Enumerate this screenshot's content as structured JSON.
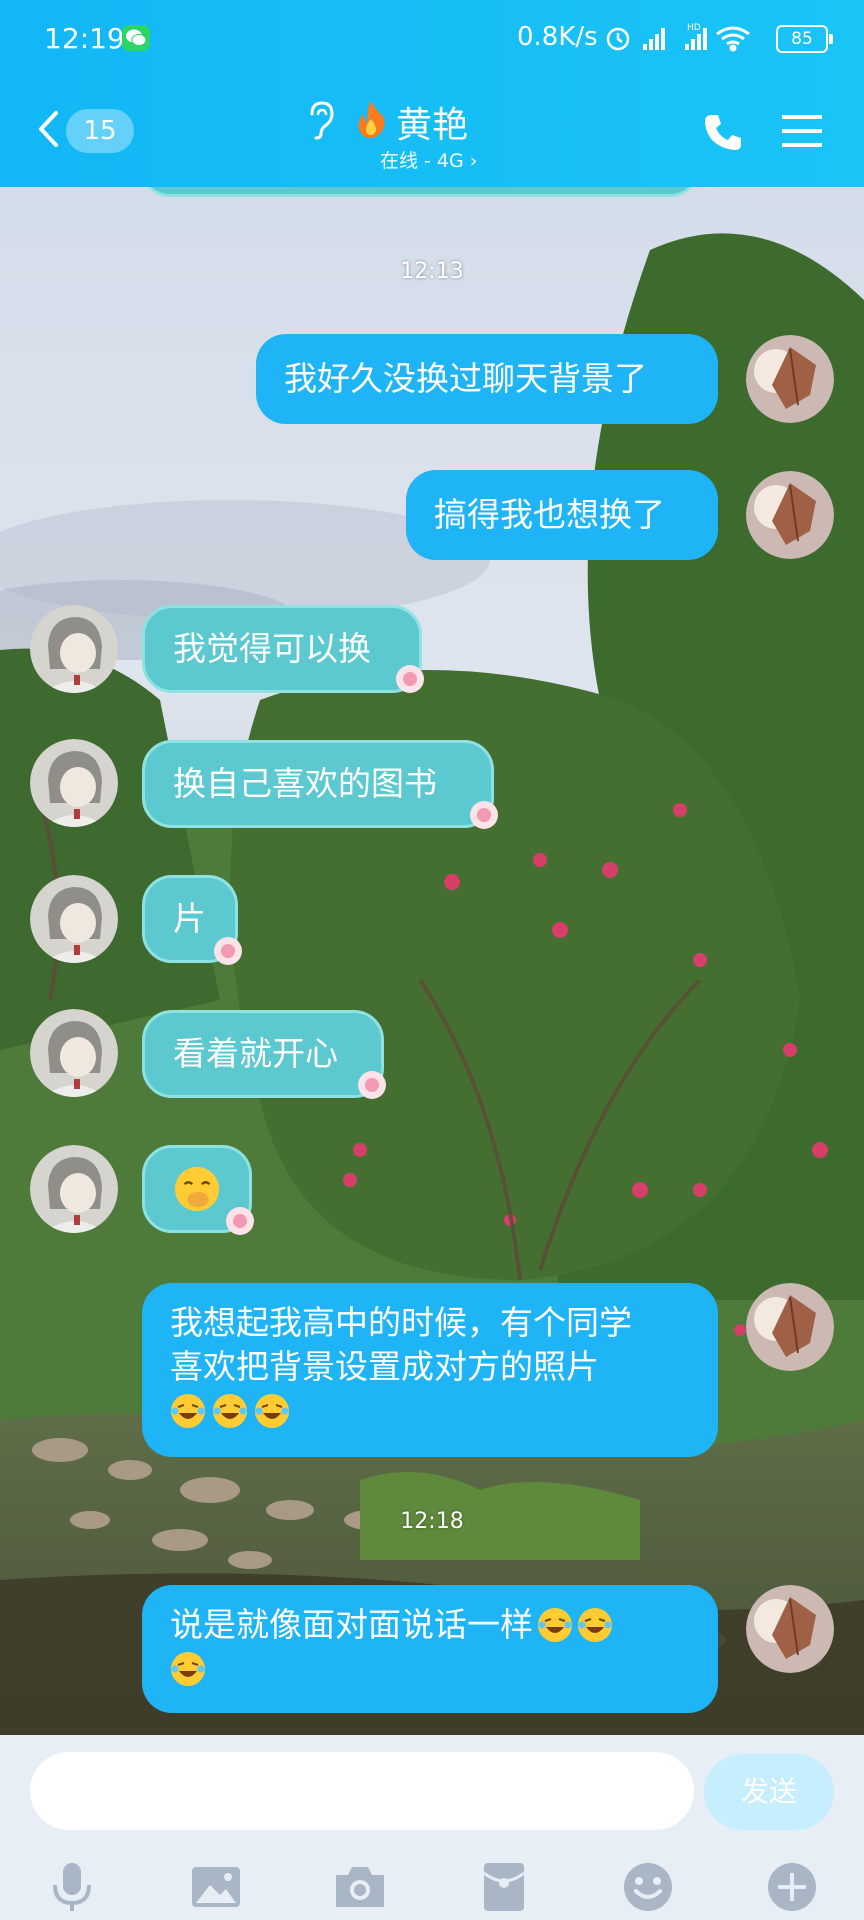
{
  "status_bar": {
    "time": "12:19",
    "net_speed": "0.8K/s",
    "battery": "85",
    "icons": [
      "wechat-icon",
      "alarm-icon",
      "signal-icon",
      "hd-signal-icon",
      "wifi-icon",
      "battery-icon"
    ]
  },
  "header": {
    "unread_count": "15",
    "contact_name": "黄艳",
    "contact_status": "在线 - 4G",
    "icons": [
      "back-arrow-icon",
      "ear-icon",
      "fire-icon",
      "phone-icon",
      "menu-icon"
    ]
  },
  "messages": {
    "ts1": "12:13",
    "m1": "我好久没换过聊天背景了",
    "m2": "搞得我也想换了",
    "m3": "我觉得可以换",
    "m4": "换自己喜欢的图书",
    "m5": "片",
    "m6": "看着就开心",
    "m7_line1": "我想起我高中的时候，有个同学",
    "m7_line2": "喜欢把背景设置成对方的照片",
    "ts2": "12:18",
    "m8": "说是就像面对面说话一样"
  },
  "input": {
    "placeholder": "",
    "send_label": "发送"
  },
  "toolbar_icons": [
    "microphone-icon",
    "image-icon",
    "camera-icon",
    "red-packet-icon",
    "emoji-icon",
    "plus-icon"
  ],
  "colors": {
    "header": "#12b7f5",
    "bubble_right": "#1fb4f5",
    "bubble_left": "#5cc8d0",
    "send_button": "#c7eefc"
  }
}
